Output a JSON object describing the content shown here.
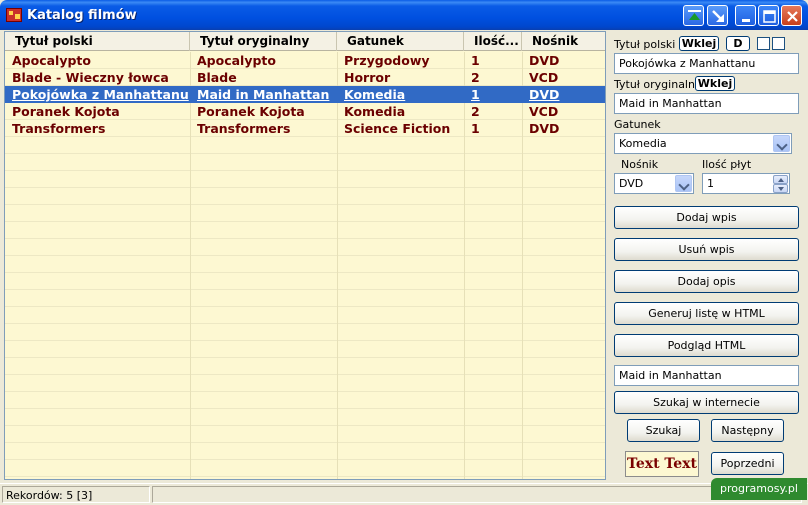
{
  "window": {
    "title": "Katalog filmów"
  },
  "grid": {
    "columns": [
      "Tytuł polski",
      "Tytuł oryginalny",
      "Gatunek",
      "Ilość...",
      "Nośnik"
    ],
    "rows": [
      [
        "Apocalypto",
        "Apocalypto",
        "Przygodowy",
        "1",
        "DVD"
      ],
      [
        "Blade - Wieczny łowca",
        "Blade",
        "Horror",
        "2",
        "VCD"
      ],
      [
        "Pokojówka z Manhattanu",
        "Maid in Manhattan",
        "Komedia",
        "1",
        "DVD"
      ],
      [
        "Poranek Kojota",
        "Poranek Kojota",
        "Komedia",
        "2",
        "VCD"
      ],
      [
        "Transformers",
        "Transformers",
        "Science Fiction",
        "1",
        "DVD"
      ]
    ],
    "selected_row": 2
  },
  "panel": {
    "polish_title_label": "Tytuł polski",
    "paste_label": "Wklej",
    "d_label": "D",
    "polish_title_value": "Pokojówka z Manhattanu",
    "original_title_label": "Tytuł oryginalny",
    "original_title_value": "Maid in Manhattan",
    "genre_label": "Gatunek",
    "genre_value": "Komedia",
    "medium_label": "Nośnik",
    "medium_value": "DVD",
    "discs_label": "Ilość płyt",
    "discs_value": "1",
    "add_entry": "Dodaj wpis",
    "delete_entry": "Usuń wpis",
    "add_description": "Dodaj opis",
    "generate_html": "Generuj listę w HTML",
    "preview_html": "Podgląd HTML",
    "search_value": "Maid in Manhattan",
    "search_web": "Szukaj w internecie",
    "search": "Szukaj",
    "next": "Następny",
    "text_sample": "Text Text",
    "previous": "Poprzedni"
  },
  "status": {
    "records": "Rekordów: 5  [3]",
    "panel2": ""
  },
  "watermark": "programosy.pl"
}
